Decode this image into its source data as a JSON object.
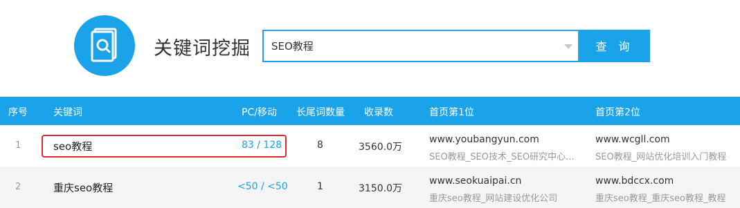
{
  "header": {
    "title": "关键词挖掘",
    "icon": "search-document-icon",
    "accent": "#1aa3e8"
  },
  "search": {
    "value": "SEO教程",
    "button_label": "查 询"
  },
  "table": {
    "columns": [
      "序号",
      "关键词",
      "PC/移动",
      "长尾词数量",
      "收录数",
      "首页第1位",
      "首页第2位"
    ],
    "rows": [
      {
        "index": "1",
        "keyword": "seo教程",
        "pc_mobile": "83 / 128",
        "longtail": "8",
        "indexed": "3560.0万",
        "first_url": "www.youbangyun.com",
        "first_title": "SEO教程_SEO技术_SEO研究中心...",
        "second_url": "www.wcgll.com",
        "second_title": "SEO教程_网站优化培训入门教程"
      },
      {
        "index": "2",
        "keyword": "重庆seo教程",
        "pc_mobile": "<50 / <50",
        "longtail": "1",
        "indexed": "3150.0万",
        "first_url": "www.seokuaipai.cn",
        "first_title": "重庆seo教程_网站建设优化公司",
        "second_url": "www.bdccx.com",
        "second_title": "重庆seo教程_重庆seo教程_教程"
      }
    ]
  }
}
